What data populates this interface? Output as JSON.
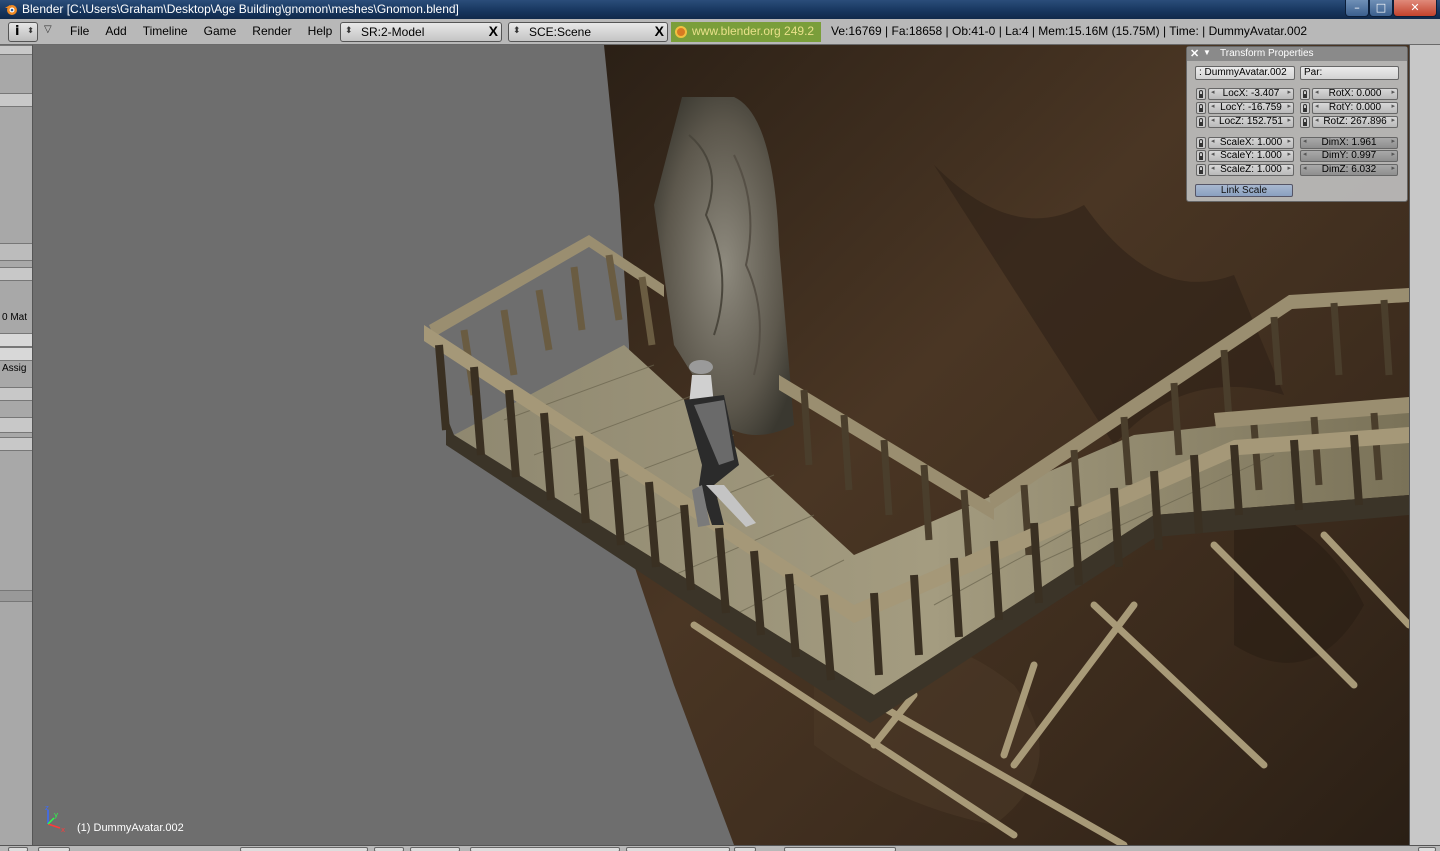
{
  "window": {
    "title": "Blender [C:\\Users\\Graham\\Desktop\\Age Building\\gnomon\\meshes\\Gnomon.blend]",
    "min_symbol": "–",
    "max_symbol": "□",
    "close_symbol": "✕"
  },
  "header": {
    "info_symbol": "i",
    "menus": [
      "File",
      "Add",
      "Timeline",
      "Game",
      "Render",
      "Help"
    ],
    "screen_selector": "SR:2-Model",
    "scene_selector": "SCE:Scene",
    "close_symbol": "X",
    "weblink": "www.blender.org 249.2",
    "stats": "Ve:16769 | Fa:18658 | Ob:41-0 | La:4  | Mem:15.16M (15.75M)  | Time: | DummyAvatar.002"
  },
  "left_panel": {
    "mat_label": "0 Mat",
    "assign_label": "Assig"
  },
  "transform_panel": {
    "title": "Transform Properties",
    "object_name": ": DummyAvatar.002",
    "parent": "Par:",
    "loc": [
      "LocX: -3.407",
      "LocY: -16.759",
      "LocZ: 152.751"
    ],
    "rot": [
      "RotX: 0.000",
      "RotY: 0.000",
      "RotZ: 267.896"
    ],
    "scale": [
      "ScaleX: 1.000",
      "ScaleY: 1.000",
      "ScaleZ: 1.000"
    ],
    "dim": [
      "DimX: 1.961",
      "DimY: 0.997",
      "DimZ: 6.032"
    ],
    "link_scale": "Link Scale"
  },
  "viewport": {
    "active_object": "(1) DummyAvatar.002",
    "axis_labels": [
      "z",
      "y",
      "x"
    ]
  },
  "colors": {
    "viewport_bg": "#6e6e6e",
    "cliff": "#3a2a1c",
    "wood_light": "#a89a78",
    "wood_dark": "#3b3428",
    "header_bg": "#b8b8b8"
  }
}
